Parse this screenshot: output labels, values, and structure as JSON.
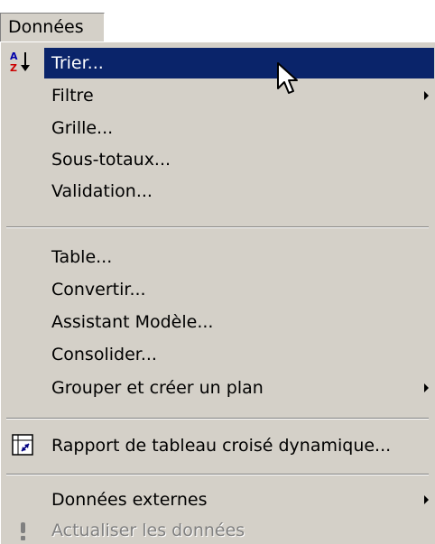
{
  "menubar": {
    "title": "Données"
  },
  "menu": {
    "items": [
      {
        "label": "Trier...",
        "icon": "sort-ascending-icon"
      },
      {
        "label": "Filtre"
      },
      {
        "label": "Grille..."
      },
      {
        "label": "Sous-totaux..."
      },
      {
        "label": "Validation..."
      },
      {
        "label": "Table..."
      },
      {
        "label": "Convertir..."
      },
      {
        "label": "Assistant Modèle..."
      },
      {
        "label": "Consolider..."
      },
      {
        "label": "Grouper et créer un plan"
      },
      {
        "label": "Rapport de tableau croisé dynamique...",
        "icon": "pivot-table-icon"
      },
      {
        "label": "Données externes"
      },
      {
        "label": "Actualiser les données",
        "icon": "refresh-exclamation-icon"
      }
    ]
  },
  "colors": {
    "menu_bg": "#d4d0c8",
    "highlight": "#0a246a",
    "disabled_text": "#808080"
  }
}
